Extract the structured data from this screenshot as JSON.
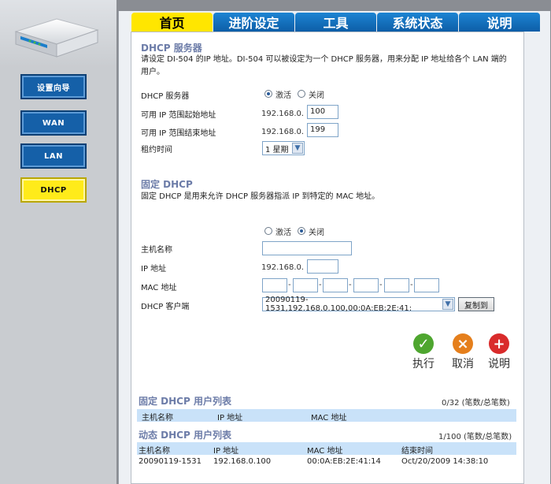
{
  "nav": {
    "wizard": "设置向导",
    "wan": "WAN",
    "lan": "LAN",
    "dhcp": "DHCP"
  },
  "tabs": [
    {
      "label": "首页"
    },
    {
      "label": "进阶设定"
    },
    {
      "label": "工具"
    },
    {
      "label": "系统状态"
    },
    {
      "label": "说明"
    }
  ],
  "dhcp_server": {
    "title": "DHCP 服务器",
    "description": "请设定 DI-504 的IP 地址。DI-504 可以被设定为一个 DHCP 服务器，用来分配 IP 地址给各个 LAN 端的用户。",
    "server_label": "DHCP 服务器",
    "enable_label": "激活",
    "disable_label": "关闭",
    "start_label": "可用 IP 范围起始地址",
    "end_label": "可用 IP 范围结束地址",
    "lease_label": "租约时间",
    "ip_prefix": "192.168.0.",
    "start_value": "100",
    "end_value": "199",
    "lease_value": "1 星期"
  },
  "fixed_dhcp": {
    "title": "固定 DHCP",
    "description": "固定 DHCP 是用来允许 DHCP 服务器指派 IP 到特定的 MAC 地址。",
    "enable_label": "激活",
    "disable_label": "关闭",
    "host_label": "主机名称",
    "ip_label": "IP 地址",
    "ip_prefix": "192.168.0.",
    "mac_label": "MAC 地址",
    "client_label": "DHCP 客户端",
    "client_value": "20090119-1531,192.168.0.100,00:0A:EB:2E:41:",
    "copy_label": "复制到"
  },
  "actions": {
    "apply": "执行",
    "cancel": "取消",
    "help": "说明"
  },
  "fixed_list": {
    "title": "固定 DHCP 用户列表",
    "count": "0/32 (笔数/总笔数)",
    "headers": [
      "主机名称",
      "IP 地址",
      "MAC 地址"
    ]
  },
  "dynamic_list": {
    "title": "动态 DHCP 用户列表",
    "count": "1/100 (笔数/总笔数)",
    "headers": [
      "主机名称",
      "IP 地址",
      "MAC 地址",
      "结束时间"
    ],
    "rows": [
      [
        "20090119-1531",
        "192.168.0.100",
        "00:0A:EB:2E:41:14",
        "Oct/20/2009 14:38:10"
      ]
    ]
  }
}
